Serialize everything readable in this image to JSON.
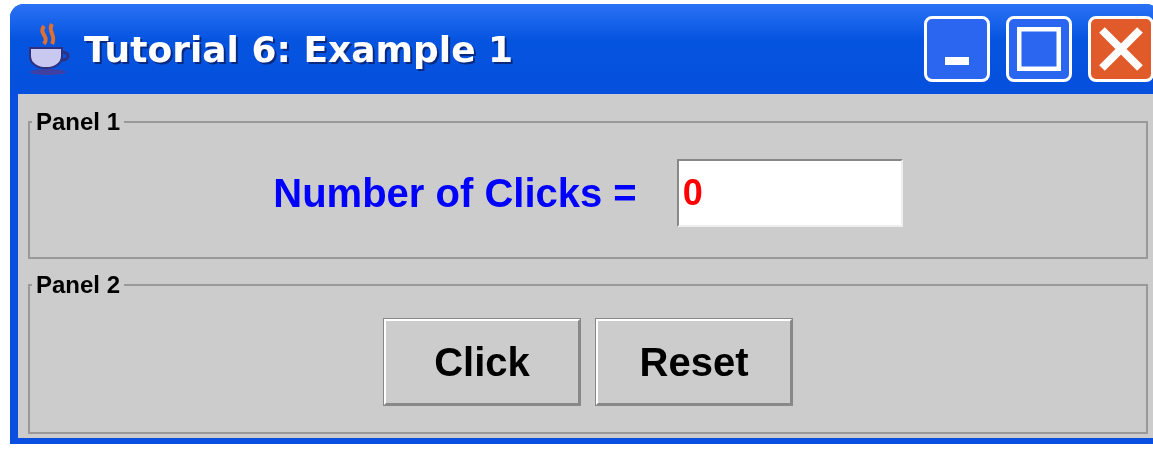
{
  "window": {
    "title": "Tutorial 6: Example 1"
  },
  "panels": [
    {
      "title": "Panel 1",
      "label": "Number of Clicks =",
      "field": {
        "value": "0"
      }
    },
    {
      "title": "Panel 2",
      "buttons": [
        "Click",
        "Reset"
      ]
    }
  ]
}
